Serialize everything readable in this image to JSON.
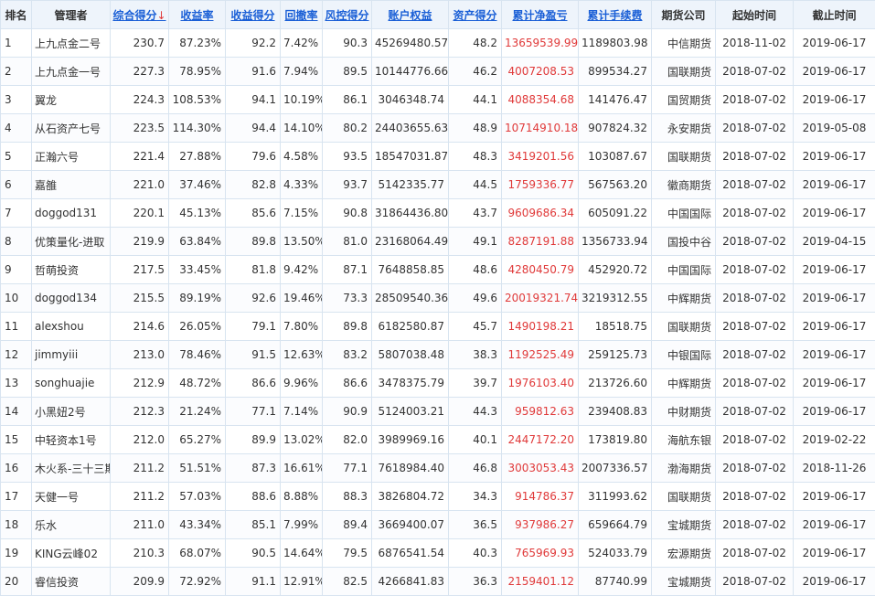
{
  "headers": {
    "rank": "排名",
    "manager": "管理者",
    "composite": "综合得分",
    "composite_arrow": "↓",
    "returns": "收益率",
    "return_score": "收益得分",
    "drawdown": "回撤率",
    "risk_score": "风控得分",
    "equity": "账户权益",
    "asset_score": "资产得分",
    "net_profit": "累计净盈亏",
    "fees": "累计手续费",
    "broker": "期货公司",
    "start": "起始时间",
    "end": "截止时间"
  },
  "rows": [
    {
      "rank": "1",
      "manager": "上九点金二号",
      "composite": "230.7",
      "returns": "87.23%",
      "return_score": "92.2",
      "drawdown": "7.42%",
      "risk_score": "90.3",
      "equity": "45269480.57",
      "asset_score": "48.2",
      "net_profit": "13659539.99",
      "fees": "1189803.98",
      "broker": "中信期货",
      "start": "2018-11-02",
      "end": "2019-06-17"
    },
    {
      "rank": "2",
      "manager": "上九点金一号",
      "composite": "227.3",
      "returns": "78.95%",
      "return_score": "91.6",
      "drawdown": "7.94%",
      "risk_score": "89.5",
      "equity": "10144776.66",
      "asset_score": "46.2",
      "net_profit": "4007208.53",
      "fees": "899534.27",
      "broker": "国联期货",
      "start": "2018-07-02",
      "end": "2019-06-17"
    },
    {
      "rank": "3",
      "manager": "翼龙",
      "composite": "224.3",
      "returns": "108.53%",
      "return_score": "94.1",
      "drawdown": "10.19%",
      "risk_score": "86.1",
      "equity": "3046348.74",
      "asset_score": "44.1",
      "net_profit": "4088354.68",
      "fees": "141476.47",
      "broker": "国贸期货",
      "start": "2018-07-02",
      "end": "2019-06-17"
    },
    {
      "rank": "4",
      "manager": "从石资产七号",
      "composite": "223.5",
      "returns": "114.30%",
      "return_score": "94.4",
      "drawdown": "14.10%",
      "risk_score": "80.2",
      "equity": "24403655.63",
      "asset_score": "48.9",
      "net_profit": "10714910.18",
      "fees": "907824.32",
      "broker": "永安期货",
      "start": "2018-07-02",
      "end": "2019-05-08"
    },
    {
      "rank": "5",
      "manager": "正瀚六号",
      "composite": "221.4",
      "returns": "27.88%",
      "return_score": "79.6",
      "drawdown": "4.58%",
      "risk_score": "93.5",
      "equity": "18547031.87",
      "asset_score": "48.3",
      "net_profit": "3419201.56",
      "fees": "103087.67",
      "broker": "国联期货",
      "start": "2018-07-02",
      "end": "2019-06-17"
    },
    {
      "rank": "6",
      "manager": "嘉雒",
      "composite": "221.0",
      "returns": "37.46%",
      "return_score": "82.8",
      "drawdown": "4.33%",
      "risk_score": "93.7",
      "equity": "5142335.77",
      "asset_score": "44.5",
      "net_profit": "1759336.77",
      "fees": "567563.20",
      "broker": "徽商期货",
      "start": "2018-07-02",
      "end": "2019-06-17"
    },
    {
      "rank": "7",
      "manager": "doggod131",
      "composite": "220.1",
      "returns": "45.13%",
      "return_score": "85.6",
      "drawdown": "7.15%",
      "risk_score": "90.8",
      "equity": "31864436.80",
      "asset_score": "43.7",
      "net_profit": "9609686.34",
      "fees": "605091.22",
      "broker": "中国国际",
      "start": "2018-07-02",
      "end": "2019-06-17"
    },
    {
      "rank": "8",
      "manager": "优策量化-进取",
      "composite": "219.9",
      "returns": "63.84%",
      "return_score": "89.8",
      "drawdown": "13.50%",
      "risk_score": "81.0",
      "equity": "23168064.49",
      "asset_score": "49.1",
      "net_profit": "8287191.88",
      "fees": "1356733.94",
      "broker": "国投中谷",
      "start": "2018-07-02",
      "end": "2019-04-15"
    },
    {
      "rank": "9",
      "manager": "哲萌投资",
      "composite": "217.5",
      "returns": "33.45%",
      "return_score": "81.8",
      "drawdown": "9.42%",
      "risk_score": "87.1",
      "equity": "7648858.85",
      "asset_score": "48.6",
      "net_profit": "4280450.79",
      "fees": "452920.72",
      "broker": "中国国际",
      "start": "2018-07-02",
      "end": "2019-06-17"
    },
    {
      "rank": "10",
      "manager": "doggod134",
      "composite": "215.5",
      "returns": "89.19%",
      "return_score": "92.6",
      "drawdown": "19.46%",
      "risk_score": "73.3",
      "equity": "28509540.36",
      "asset_score": "49.6",
      "net_profit": "20019321.74",
      "fees": "3219312.55",
      "broker": "中辉期货",
      "start": "2018-07-02",
      "end": "2019-06-17"
    },
    {
      "rank": "11",
      "manager": "alexshou",
      "composite": "214.6",
      "returns": "26.05%",
      "return_score": "79.1",
      "drawdown": "7.80%",
      "risk_score": "89.8",
      "equity": "6182580.87",
      "asset_score": "45.7",
      "net_profit": "1490198.21",
      "fees": "18518.75",
      "broker": "国联期货",
      "start": "2018-07-02",
      "end": "2019-06-17"
    },
    {
      "rank": "12",
      "manager": "jimmyiii",
      "composite": "213.0",
      "returns": "78.46%",
      "return_score": "91.5",
      "drawdown": "12.63%",
      "risk_score": "83.2",
      "equity": "5807038.48",
      "asset_score": "38.3",
      "net_profit": "1192525.49",
      "fees": "259125.73",
      "broker": "中银国际",
      "start": "2018-07-02",
      "end": "2019-06-17"
    },
    {
      "rank": "13",
      "manager": "songhuajie",
      "composite": "212.9",
      "returns": "48.72%",
      "return_score": "86.6",
      "drawdown": "9.96%",
      "risk_score": "86.6",
      "equity": "3478375.79",
      "asset_score": "39.7",
      "net_profit": "1976103.40",
      "fees": "213726.60",
      "broker": "中辉期货",
      "start": "2018-07-02",
      "end": "2019-06-17"
    },
    {
      "rank": "14",
      "manager": "小黑妞2号",
      "composite": "212.3",
      "returns": "21.24%",
      "return_score": "77.1",
      "drawdown": "7.14%",
      "risk_score": "90.9",
      "equity": "5124003.21",
      "asset_score": "44.3",
      "net_profit": "959812.63",
      "fees": "239408.83",
      "broker": "中财期货",
      "start": "2018-07-02",
      "end": "2019-06-17"
    },
    {
      "rank": "15",
      "manager": "中轻资本1号",
      "composite": "212.0",
      "returns": "65.27%",
      "return_score": "89.9",
      "drawdown": "13.02%",
      "risk_score": "82.0",
      "equity": "3989969.16",
      "asset_score": "40.1",
      "net_profit": "2447172.20",
      "fees": "173819.80",
      "broker": "海航东银",
      "start": "2018-07-02",
      "end": "2019-02-22"
    },
    {
      "rank": "16",
      "manager": "木火系-三十三期",
      "composite": "211.2",
      "returns": "51.51%",
      "return_score": "87.3",
      "drawdown": "16.61%",
      "risk_score": "77.1",
      "equity": "7618984.40",
      "asset_score": "46.8",
      "net_profit": "3003053.43",
      "fees": "2007336.57",
      "broker": "渤海期货",
      "start": "2018-07-02",
      "end": "2018-11-26"
    },
    {
      "rank": "17",
      "manager": "天健一号",
      "composite": "211.2",
      "returns": "57.03%",
      "return_score": "88.6",
      "drawdown": "8.88%",
      "risk_score": "88.3",
      "equity": "3826804.72",
      "asset_score": "34.3",
      "net_profit": "914786.37",
      "fees": "311993.62",
      "broker": "国联期货",
      "start": "2018-07-02",
      "end": "2019-06-17"
    },
    {
      "rank": "18",
      "manager": "乐水",
      "composite": "211.0",
      "returns": "43.34%",
      "return_score": "85.1",
      "drawdown": "7.99%",
      "risk_score": "89.4",
      "equity": "3669400.07",
      "asset_score": "36.5",
      "net_profit": "937986.27",
      "fees": "659664.79",
      "broker": "宝城期货",
      "start": "2018-07-02",
      "end": "2019-06-17"
    },
    {
      "rank": "19",
      "manager": "KING云峰02",
      "composite": "210.3",
      "returns": "68.07%",
      "return_score": "90.5",
      "drawdown": "14.64%",
      "risk_score": "79.5",
      "equity": "6876541.54",
      "asset_score": "40.3",
      "net_profit": "765969.93",
      "fees": "524033.79",
      "broker": "宏源期货",
      "start": "2018-07-02",
      "end": "2019-06-17"
    },
    {
      "rank": "20",
      "manager": "睿信投资",
      "composite": "209.9",
      "returns": "72.92%",
      "return_score": "91.1",
      "drawdown": "12.91%",
      "risk_score": "82.5",
      "equity": "4266841.83",
      "asset_score": "36.3",
      "net_profit": "2159401.12",
      "fees": "87740.99",
      "broker": "宝城期货",
      "start": "2018-07-02",
      "end": "2019-06-17"
    }
  ]
}
